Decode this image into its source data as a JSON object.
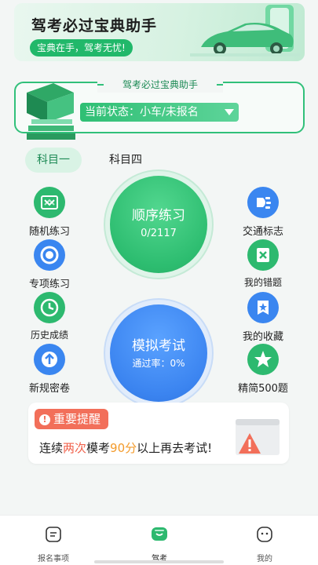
{
  "banner": {
    "title": "驾考必过宝典助手",
    "slogan": "宝典在手，驾考无忧!"
  },
  "status": {
    "tag": "驾考必过宝典助手",
    "current": "当前状态：小车/未报名"
  },
  "tabs": [
    {
      "label": "科目一",
      "active": true
    },
    {
      "label": "科目四",
      "active": false
    }
  ],
  "left_items": [
    {
      "label": "随机练习",
      "icon": "shuffle-icon"
    },
    {
      "label": "专项练习",
      "icon": "target-icon"
    },
    {
      "label": "历史成绩",
      "icon": "clock-icon"
    },
    {
      "label": "新规密卷",
      "icon": "upload-icon"
    }
  ],
  "right_items": [
    {
      "label": "交通标志",
      "icon": "signal-icon"
    },
    {
      "label": "我的错题",
      "icon": "wrong-note-icon"
    },
    {
      "label": "我的收藏",
      "icon": "bookmark-star-icon"
    },
    {
      "label": "精简500题",
      "icon": "star-icon"
    }
  ],
  "practice": {
    "title": "顺序练习",
    "progress": "0/2117"
  },
  "exam": {
    "title": "模拟考试",
    "pass_rate": "通过率：0%"
  },
  "reminder": {
    "tag": "重要提醒",
    "bang": "!",
    "text_1": "连续",
    "text_2": "两次",
    "text_3": "模考",
    "text_4": "90分",
    "text_5": "以上再去考试!"
  },
  "bottom_nav": [
    {
      "label": "报名事项",
      "icon": "document-icon"
    },
    {
      "label": "驾考",
      "icon": "chat-bubble-icon",
      "active": true
    },
    {
      "label": "我的",
      "icon": "face-icon"
    }
  ],
  "colors": {
    "accent_green": "#2db96f",
    "accent_blue": "#3a86f0",
    "warning_red": "#f26f5a"
  }
}
